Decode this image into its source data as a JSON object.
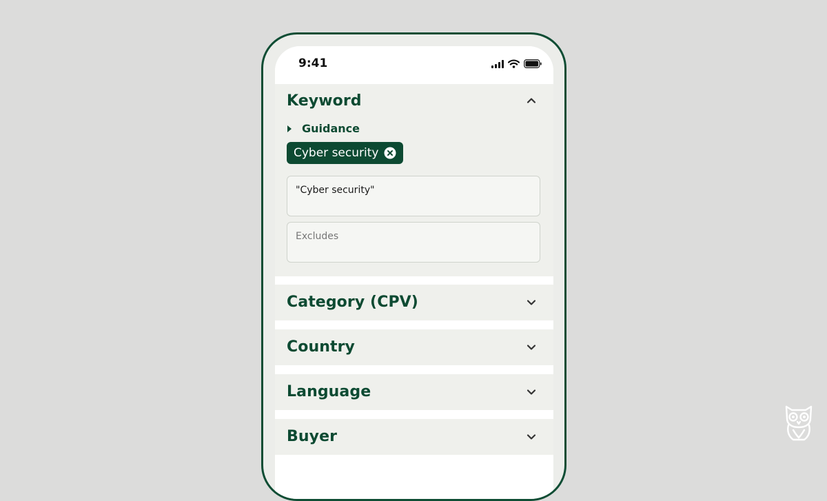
{
  "status_bar": {
    "time": "9:41"
  },
  "keyword": {
    "title": "Keyword",
    "expanded": true,
    "guidance_label": "Guidance",
    "chip_label": "Cyber security",
    "includes_value": "\"Cyber security\"",
    "excludes_placeholder": "Excludes"
  },
  "sections": [
    {
      "title": "Category (CPV)",
      "expanded": false
    },
    {
      "title": "Country",
      "expanded": false
    },
    {
      "title": "Language",
      "expanded": false
    },
    {
      "title": "Buyer",
      "expanded": false
    }
  ],
  "colors": {
    "brand_green": "#0d4a32",
    "background": "#dcdcdb",
    "panel": "#eff0ec"
  },
  "icons": [
    "signal-icon",
    "wifi-icon",
    "battery-icon",
    "chevron-up-icon",
    "chevron-down-icon",
    "caret-right-icon",
    "close-circle-icon",
    "owl-logo-icon"
  ]
}
